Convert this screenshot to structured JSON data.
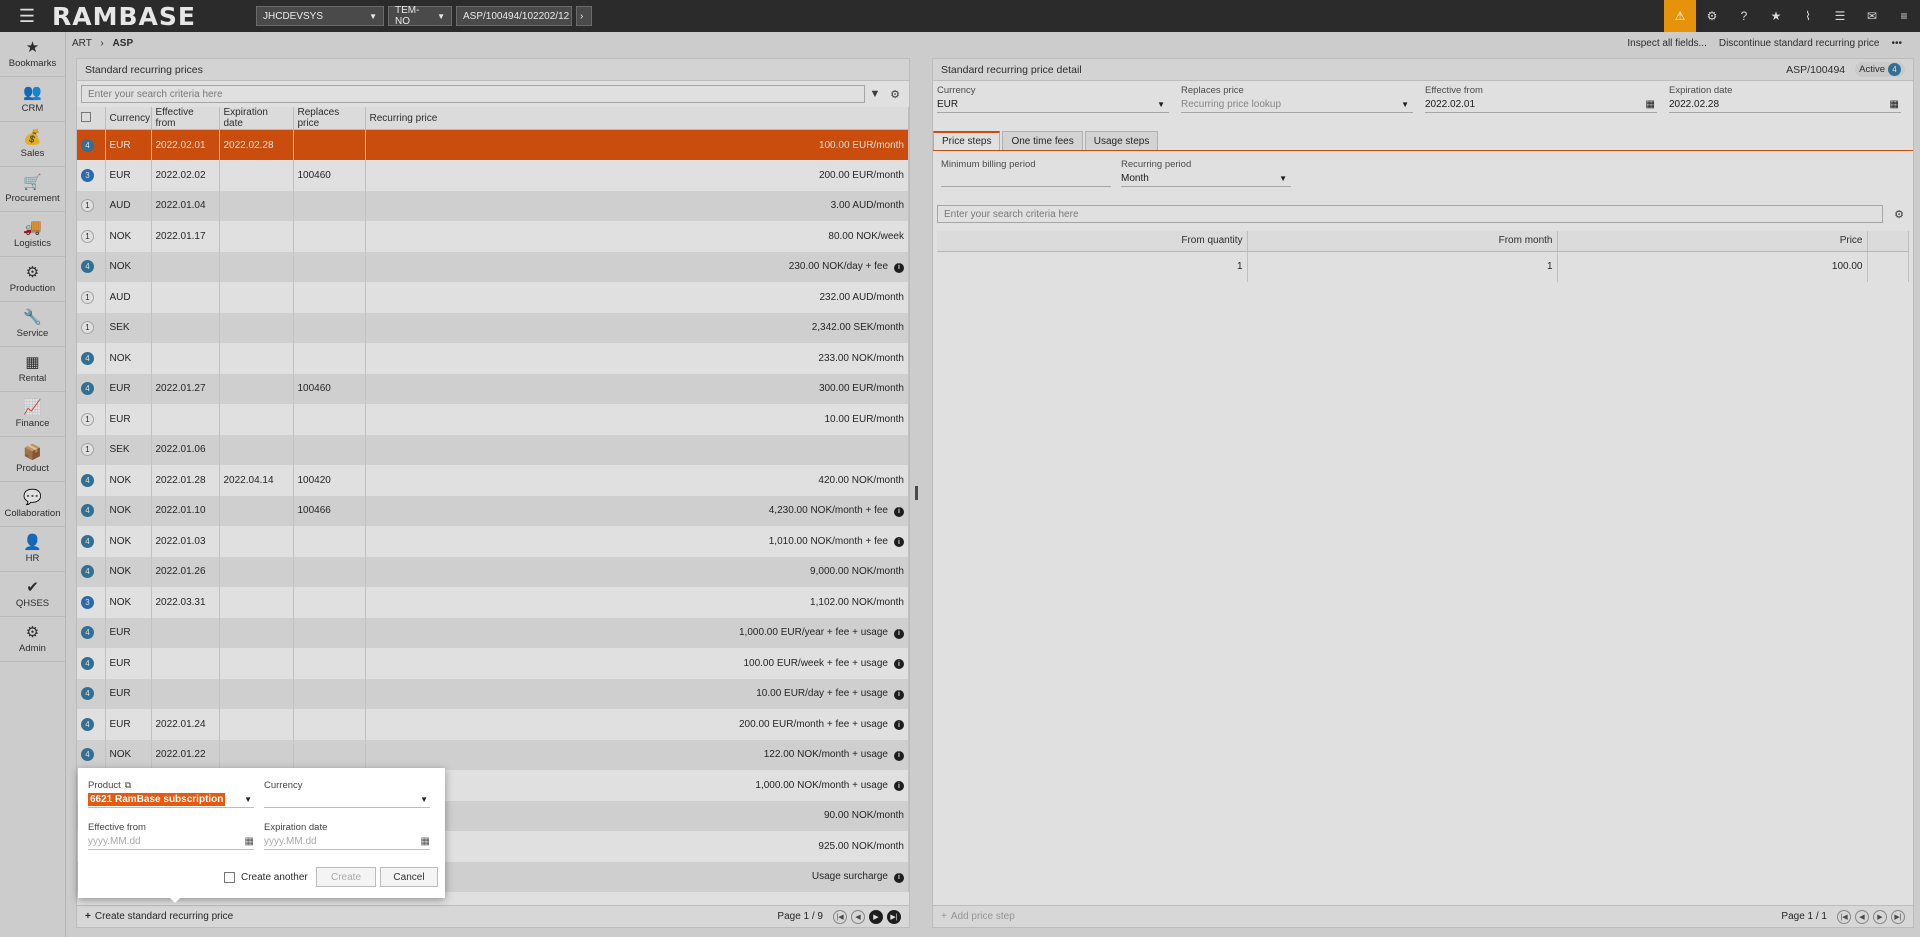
{
  "topbar": {
    "brand": "RAMBASE",
    "company": "JHCDEVSYS",
    "region": "TEM-NO",
    "object": "ASP/100494/102202/12",
    "icons": [
      "warning-icon",
      "settings-icon",
      "help-icon",
      "star-icon",
      "attachment-icon",
      "list-icon",
      "mail-icon",
      "menu-icon"
    ]
  },
  "nav": [
    {
      "label": "Bookmarks",
      "icon": "★"
    },
    {
      "label": "CRM",
      "icon": "👥"
    },
    {
      "label": "Sales",
      "icon": "💰"
    },
    {
      "label": "Procurement",
      "icon": "🛒"
    },
    {
      "label": "Logistics",
      "icon": "🚚"
    },
    {
      "label": "Production",
      "icon": "⚙"
    },
    {
      "label": "Service",
      "icon": "🔧"
    },
    {
      "label": "Rental",
      "icon": "▦"
    },
    {
      "label": "Finance",
      "icon": "📈"
    },
    {
      "label": "Product",
      "icon": "📦"
    },
    {
      "label": "Collaboration",
      "icon": "💬"
    },
    {
      "label": "HR",
      "icon": "👤"
    },
    {
      "label": "QHSES",
      "icon": "✔"
    },
    {
      "label": "Admin",
      "icon": "⚙"
    }
  ],
  "breadcrumb": {
    "root": "ART",
    "sep": "›",
    "current": "ASP"
  },
  "header_actions": {
    "inspect": "Inspect all fields...",
    "discontinue": "Discontinue standard recurring price",
    "more": "•••"
  },
  "list": {
    "title": "Standard recurring prices",
    "search_placeholder": "Enter your search criteria here",
    "columns": [
      "Currency",
      "Effective from",
      "Expiration date",
      "Replaces price",
      "Recurring price"
    ],
    "rows": [
      {
        "st": "4",
        "cur": "EUR",
        "eff": "2022.02.01",
        "exp": "2022.02.28",
        "rep": "",
        "price": "100.00 EUR/month",
        "info": false
      },
      {
        "st": "3",
        "cur": "EUR",
        "eff": "2022.02.02",
        "exp": "",
        "rep": "100460",
        "price": "200.00 EUR/month",
        "info": false
      },
      {
        "st": "1",
        "cur": "AUD",
        "eff": "2022.01.04",
        "exp": "",
        "rep": "",
        "price": "3.00 AUD/month",
        "info": false
      },
      {
        "st": "1",
        "cur": "NOK",
        "eff": "2022.01.17",
        "exp": "",
        "rep": "",
        "price": "80.00 NOK/week",
        "info": false
      },
      {
        "st": "4",
        "cur": "NOK",
        "eff": "",
        "exp": "",
        "rep": "",
        "price": "230.00 NOK/day + fee",
        "info": true
      },
      {
        "st": "1",
        "cur": "AUD",
        "eff": "",
        "exp": "",
        "rep": "",
        "price": "232.00 AUD/month",
        "info": false
      },
      {
        "st": "1",
        "cur": "SEK",
        "eff": "",
        "exp": "",
        "rep": "",
        "price": "2,342.00 SEK/month",
        "info": false
      },
      {
        "st": "4",
        "cur": "NOK",
        "eff": "",
        "exp": "",
        "rep": "",
        "price": "233.00 NOK/month",
        "info": false
      },
      {
        "st": "4",
        "cur": "EUR",
        "eff": "2022.01.27",
        "exp": "",
        "rep": "100460",
        "price": "300.00 EUR/month",
        "info": false
      },
      {
        "st": "1",
        "cur": "EUR",
        "eff": "",
        "exp": "",
        "rep": "",
        "price": "10.00 EUR/month",
        "info": false
      },
      {
        "st": "1",
        "cur": "SEK",
        "eff": "2022.01.06",
        "exp": "",
        "rep": "",
        "price": "",
        "info": false
      },
      {
        "st": "4",
        "cur": "NOK",
        "eff": "2022.01.28",
        "exp": "2022.04.14",
        "rep": "100420",
        "price": "420.00 NOK/month",
        "info": false
      },
      {
        "st": "4",
        "cur": "NOK",
        "eff": "2022.01.10",
        "exp": "",
        "rep": "100466",
        "price": "4,230.00 NOK/month + fee",
        "info": true
      },
      {
        "st": "4",
        "cur": "NOK",
        "eff": "2022.01.03",
        "exp": "",
        "rep": "",
        "price": "1,010.00 NOK/month + fee",
        "info": true
      },
      {
        "st": "4",
        "cur": "NOK",
        "eff": "2022.01.26",
        "exp": "",
        "rep": "",
        "price": "9,000.00 NOK/month",
        "info": false
      },
      {
        "st": "3",
        "cur": "NOK",
        "eff": "2022.03.31",
        "exp": "",
        "rep": "",
        "price": "1,102.00 NOK/month",
        "info": false
      },
      {
        "st": "4",
        "cur": "EUR",
        "eff": "",
        "exp": "",
        "rep": "",
        "price": "1,000.00 EUR/year + fee + usage",
        "info": true
      },
      {
        "st": "4",
        "cur": "EUR",
        "eff": "",
        "exp": "",
        "rep": "",
        "price": "100.00 EUR/week + fee + usage",
        "info": true
      },
      {
        "st": "4",
        "cur": "EUR",
        "eff": "",
        "exp": "",
        "rep": "",
        "price": "10.00 EUR/day + fee + usage",
        "info": true
      },
      {
        "st": "4",
        "cur": "EUR",
        "eff": "2022.01.24",
        "exp": "",
        "rep": "",
        "price": "200.00 EUR/month + fee + usage",
        "info": true
      },
      {
        "st": "4",
        "cur": "NOK",
        "eff": "2022.01.22",
        "exp": "",
        "rep": "",
        "price": "122.00 NOK/month + usage",
        "info": true
      },
      {
        "st": "",
        "cur": "",
        "eff": "",
        "exp": "",
        "rep": "",
        "price": "1,000.00 NOK/month + usage",
        "info": true
      },
      {
        "st": "",
        "cur": "",
        "eff": "",
        "exp": "",
        "rep": "",
        "price": "90.00 NOK/month",
        "info": false
      },
      {
        "st": "",
        "cur": "",
        "eff": "",
        "exp": "",
        "rep": "",
        "price": "925.00 NOK/month",
        "info": false
      },
      {
        "st": "",
        "cur": "",
        "eff": "",
        "exp": "",
        "rep": "",
        "price": "Usage surcharge",
        "info": true
      }
    ],
    "create_label": "Create standard recurring price",
    "page_text": "Page 1 / 9"
  },
  "detail": {
    "title": "Standard recurring price detail",
    "id": "ASP/100494",
    "status_label": "Active",
    "status_num": "4",
    "currency_label": "Currency",
    "currency_value": "EUR",
    "replaces_label": "Replaces price",
    "replaces_placeholder": "Recurring price lookup",
    "eff_label": "Effective from",
    "eff_value": "2022.02.01",
    "exp_label": "Expiration date",
    "exp_value": "2022.02.28",
    "tabs": [
      "Price steps",
      "One time fees",
      "Usage steps"
    ],
    "min_billing_label": "Minimum billing period",
    "rec_period_label": "Recurring period",
    "rec_period_value": "Month",
    "search_placeholder": "Enter your search criteria here",
    "columns": [
      "From quantity",
      "From month",
      "Price"
    ],
    "rows": [
      {
        "q": "1",
        "m": "1",
        "p": "100.00"
      }
    ],
    "add_label": "Add price step",
    "page_text": "Page 1 / 1"
  },
  "modal": {
    "product_label": "Product",
    "product_value": "6621 RamBase subscription",
    "currency_label": "Currency",
    "eff_label": "Effective from",
    "eff_placeholder": "yyyy.MM.dd",
    "exp_label": "Expiration date",
    "exp_placeholder": "yyyy.MM.dd",
    "create_another": "Create another",
    "create": "Create",
    "cancel": "Cancel"
  }
}
